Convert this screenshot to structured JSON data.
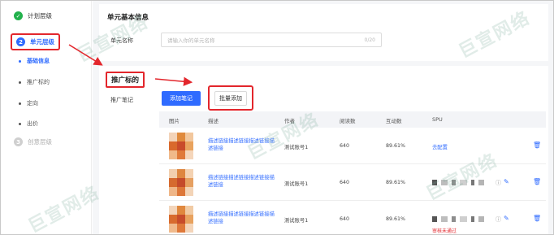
{
  "sidebar": {
    "steps": [
      {
        "num": "✓",
        "label": "计划层级"
      },
      {
        "num": "2",
        "label": "单元层级"
      },
      {
        "num": "3",
        "label": "创意层级"
      }
    ],
    "sub_items": [
      "基础信息",
      "推广标的",
      "定向",
      "出价"
    ]
  },
  "basic_info": {
    "title": "单元基本信息",
    "name_label": "单元名称",
    "name_placeholder": "请输入你的单元名称",
    "name_count": "0/20"
  },
  "promo": {
    "title": "推广标的",
    "row_label": "推广笔记",
    "add_button": "添加笔记",
    "batch_button": "批量添加"
  },
  "table": {
    "headers": [
      "图片",
      "描述",
      "作者",
      "阅读数",
      "互动数",
      "SPU"
    ],
    "rows": [
      {
        "desc": "描述链接描述链接描述链接描述链接",
        "author": "测试账号1",
        "reads": "640",
        "interact": "89.61%",
        "spu": "去配置",
        "spu_status": ""
      },
      {
        "desc": "描述链接描述链接描述链接描述链接",
        "author": "测试账号1",
        "reads": "640",
        "interact": "89.61%",
        "spu": "",
        "spu_status": ""
      },
      {
        "desc": "描述链接描述链接描述链接描述链接",
        "author": "测试账号1",
        "reads": "640",
        "interact": "89.61%",
        "spu": "",
        "spu_status": "审核未通过"
      }
    ]
  },
  "watermark": "巨宣网络",
  "colors": {
    "accent": "#2f6bff",
    "highlight": "#e3262c",
    "success": "#22b14c"
  }
}
